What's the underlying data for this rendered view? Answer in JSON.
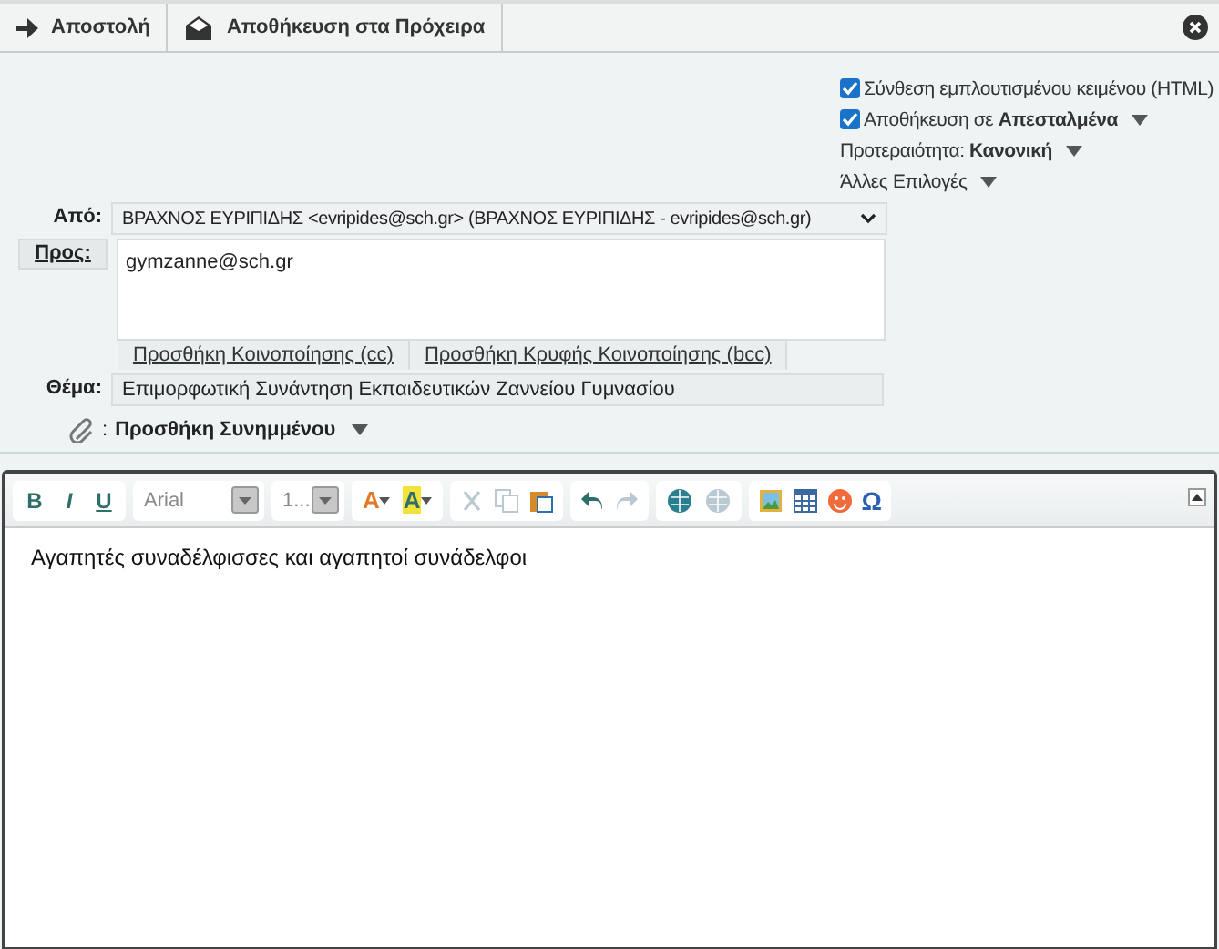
{
  "toolbar": {
    "buttons": [
      {
        "kind": "send",
        "label": "Αποστολή"
      },
      {
        "kind": "draft",
        "label": "Αποθήκευση στα Πρόχειρα"
      }
    ]
  },
  "options": {
    "html": {
      "label": "Σύνθεση εμπλουτισμένου κειμένου (HTML)",
      "checked": true
    },
    "save": {
      "label": "Αποθήκευση σε",
      "folder": "Απεσταλμένα",
      "checked": true
    },
    "priority": {
      "label": "Προτεραιότητα:",
      "value": "Κανονική"
    },
    "more": {
      "label": "Άλλες Επιλογές"
    }
  },
  "from": {
    "label": "Από:",
    "value": "ΒΡΑΧΝΟΣ ΕΥΡΙΠΙΔΗΣ <evripides@sch.gr> (ΒΡΑΧΝΟΣ ΕΥΡΙΠΙΔΗΣ - evripides@sch.gr)"
  },
  "to": {
    "label": "Προς:",
    "value": "gymzanne@sch.gr"
  },
  "cc_links": [
    "Προσθήκη Κοινοποίησης (cc)",
    "Προσθήκη Κρυφής Κοινοποίησης (bcc)"
  ],
  "subject": {
    "label": "Θέμα:",
    "value": "Επιμορφωτική Συνάντηση Εκπαιδευτικών Ζαννείου Γυμνασίου"
  },
  "attachment": {
    "separator": ":",
    "label": "Προσθήκη Συνημμένου"
  },
  "editor": {
    "format_buttons": [
      "B",
      "I",
      "U"
    ],
    "font": "Arial",
    "size": "1...",
    "color_buttons": [
      {
        "kind": "text-color",
        "glyph": "A"
      },
      {
        "kind": "background-color",
        "glyph": "A"
      }
    ],
    "tool_groups": [
      [
        {
          "kind": "cut",
          "disabled": true
        },
        {
          "kind": "copy",
          "disabled": true
        },
        {
          "kind": "paste",
          "disabled": false
        }
      ],
      [
        {
          "kind": "undo",
          "disabled": false
        },
        {
          "kind": "redo",
          "disabled": true
        }
      ],
      [
        {
          "kind": "link",
          "disabled": false
        },
        {
          "kind": "unlink",
          "disabled": true
        }
      ],
      [
        {
          "kind": "image",
          "disabled": false
        },
        {
          "kind": "table",
          "disabled": false
        },
        {
          "kind": "emoji",
          "disabled": false
        },
        {
          "kind": "symbol",
          "glyph": "Ω",
          "disabled": false
        }
      ]
    ],
    "body": "Αγαπητές συναδέλφισσες και αγαπητοί συνάδελφοι"
  }
}
